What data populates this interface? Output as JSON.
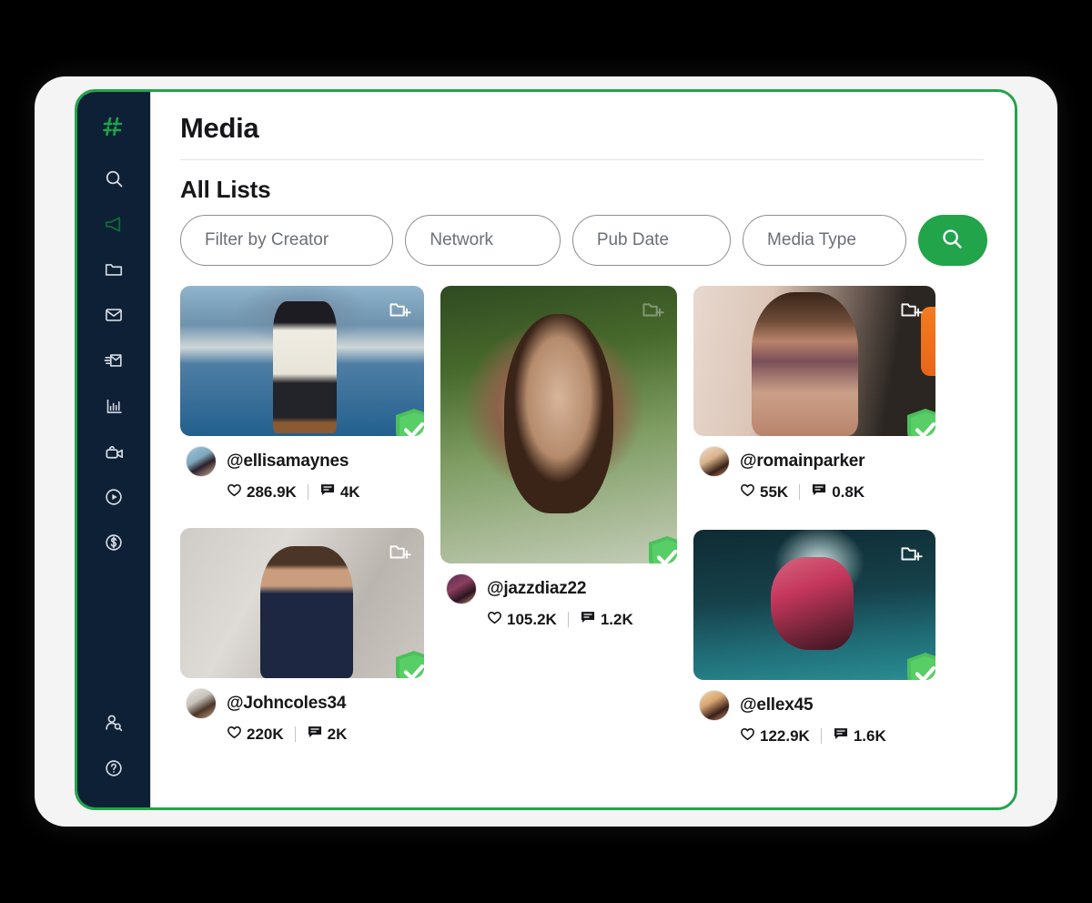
{
  "header": {
    "page_title": "Media",
    "section_title": "All Lists"
  },
  "filters": {
    "creator_placeholder": "Filter by Creator",
    "network_placeholder": "Network",
    "pub_date_placeholder": "Pub Date",
    "media_type_placeholder": "Media Type",
    "search_icon": "search-icon",
    "search_button_color": "#22a44b"
  },
  "sidebar": {
    "background_color": "#0d2036",
    "accent_color": "#22a44b",
    "items": [
      {
        "icon": "hashtag-logo-icon",
        "active": true
      },
      {
        "icon": "search-icon",
        "active": false
      },
      {
        "icon": "megaphone-icon",
        "active": true
      },
      {
        "icon": "folder-icon",
        "active": false
      },
      {
        "icon": "envelope-icon",
        "active": false
      },
      {
        "icon": "send-mail-icon",
        "active": false
      },
      {
        "icon": "bar-chart-icon",
        "active": false
      },
      {
        "icon": "video-camera-icon",
        "active": false
      },
      {
        "icon": "play-circle-icon",
        "active": false
      },
      {
        "icon": "dollar-circle-icon",
        "active": false
      }
    ],
    "bottom_items": [
      {
        "icon": "user-search-icon"
      },
      {
        "icon": "help-circle-icon"
      }
    ]
  },
  "media_cards": [
    {
      "id": "ellisamaynes",
      "handle": "@ellisamaynes",
      "likes": "286.9K",
      "comments": "4K",
      "verified": true,
      "add_to_list_icon": "folder-add-icon",
      "column": "left"
    },
    {
      "id": "jazzdiaz22",
      "handle": "@jazzdiaz22",
      "likes": "105.2K",
      "comments": "1.2K",
      "verified": true,
      "add_to_list_icon": "folder-add-icon",
      "column": "middle"
    },
    {
      "id": "romainparker",
      "handle": "@romainparker",
      "likes": "55K",
      "comments": "0.8K",
      "verified": true,
      "add_to_list_icon": "folder-add-icon",
      "column": "right"
    },
    {
      "id": "Johncoles34",
      "handle": "@Johncoles34",
      "likes": "220K",
      "comments": "2K",
      "verified": true,
      "add_to_list_icon": "folder-add-icon",
      "column": "left"
    },
    {
      "id": "ellex45",
      "handle": "@ellex45",
      "likes": "122.9K",
      "comments": "1.6K",
      "verified": true,
      "add_to_list_icon": "folder-add-icon",
      "column": "right"
    }
  ],
  "icons": {
    "like": "heart-icon",
    "comment": "comment-icon",
    "verified": "verified-shield-icon"
  }
}
